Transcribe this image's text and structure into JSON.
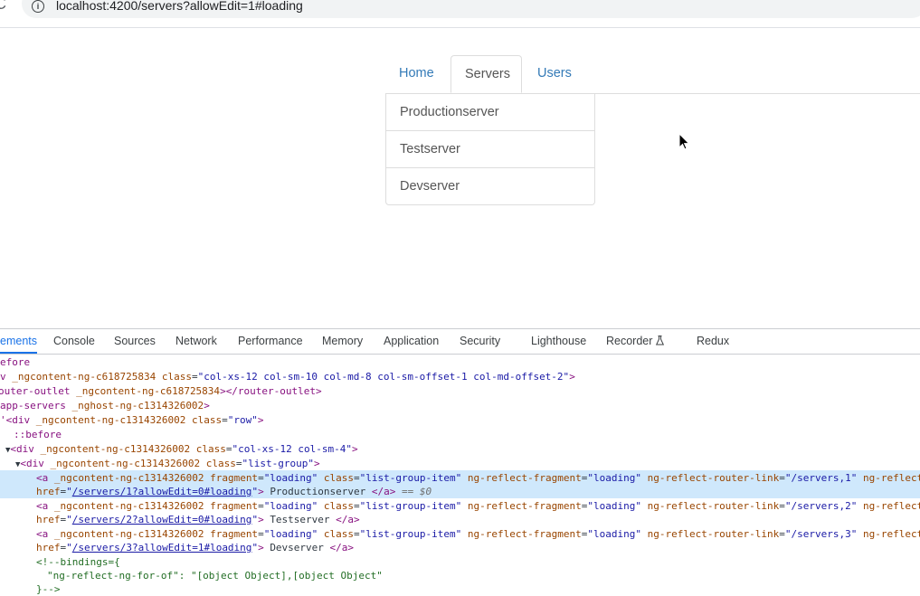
{
  "browser": {
    "url": "localhost:4200/servers?allowEdit=1#loading",
    "reload_glyph": "C",
    "info_glyph": "i"
  },
  "nav": {
    "tabs": [
      {
        "label": "Home",
        "active": false
      },
      {
        "label": "Servers",
        "active": true
      },
      {
        "label": "Users",
        "active": false
      }
    ]
  },
  "servers": {
    "items": [
      "Productionserver",
      "Testserver",
      "Devserver"
    ]
  },
  "devtools": {
    "tabs": [
      "ements",
      "Console",
      "Sources",
      "Network",
      "Performance",
      "Memory",
      "Application",
      "Security",
      "Lighthouse",
      "Recorder",
      "Redux"
    ],
    "active_tab": "ements",
    "dom_lines": {
      "l1": "efore",
      "l2_prefix": "v ",
      "l2_attr1": "_ngcontent-ng-c618725834",
      "l2_attr2": "class",
      "l2_val2": "\"col-xs-12 col-sm-10 col-md-8 col-sm-offset-1 col-md-offset-2\"",
      "l3_tag": "outer-outlet",
      "l3_attr": "_ngcontent-ng-c618725834",
      "l3_close": "</router-outlet>",
      "l4_tag": "app-servers",
      "l4_attr": "_nghost-ng-c1314326002",
      "l5_attr": "_ngcontent-ng-c1314326002",
      "l5_val": "\"row\"",
      "l6": "::before",
      "l7_val": "\"col-xs-12 col-sm-4\"",
      "l8_val": "\"list-group\"",
      "a_frag": "\"loading\"",
      "a_class": "\"list-group-item\"",
      "a_reflect": "\"loading\"",
      "a1_link": "\"/servers,1\"",
      "a2_link": "\"/servers,2\"",
      "a3_link": "\"/servers,3\"",
      "a_trail": "ng-reflect",
      "a1_href": "/servers/1?allowEdit=0#loading",
      "a2_href": "/servers/2?allowEdit=0#loading",
      "a3_href": "/servers/3?allowEdit=1#loading",
      "a1_text": "Productionserver",
      "a2_text": "Testserver",
      "a3_text": "Devserver",
      "a1_marker": "== $0",
      "cm1": "<!--bindings={",
      "cm2": "\"ng-reflect-ng-for-of\": \"[object Object],[object Object\"",
      "cm3": "}-->"
    }
  }
}
